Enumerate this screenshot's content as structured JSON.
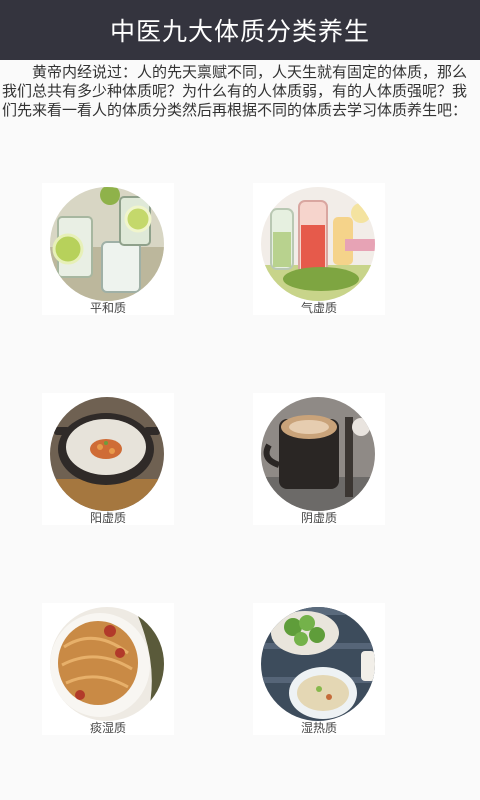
{
  "header": {
    "title": "中医九大体质分类养生"
  },
  "intro": {
    "text": "黄帝内经说过：人的先天禀赋不同，人天生就有固定的体质，那么我们总共有多少种体质呢？为什么有的人体质弱，有的人体质强呢？我们先来看一看人的体质分类然后再根据不同的体质去学习体质养生吧："
  },
  "categories": [
    {
      "label": "平和质",
      "image": "lemon-water-drinks-image"
    },
    {
      "label": "气虚质",
      "image": "fruit-juice-bottles-image"
    },
    {
      "label": "阳虚质",
      "image": "congee-in-clay-pot-image"
    },
    {
      "label": "阴虚质",
      "image": "coffee-latte-cup-image"
    },
    {
      "label": "痰湿质",
      "image": "noodles-plate-image"
    },
    {
      "label": "湿热质",
      "image": "broccoli-and-porridge-image"
    }
  ],
  "colors": {
    "header_bg": "#34343e",
    "header_text": "#ffffff",
    "page_bg": "#fafafa"
  }
}
